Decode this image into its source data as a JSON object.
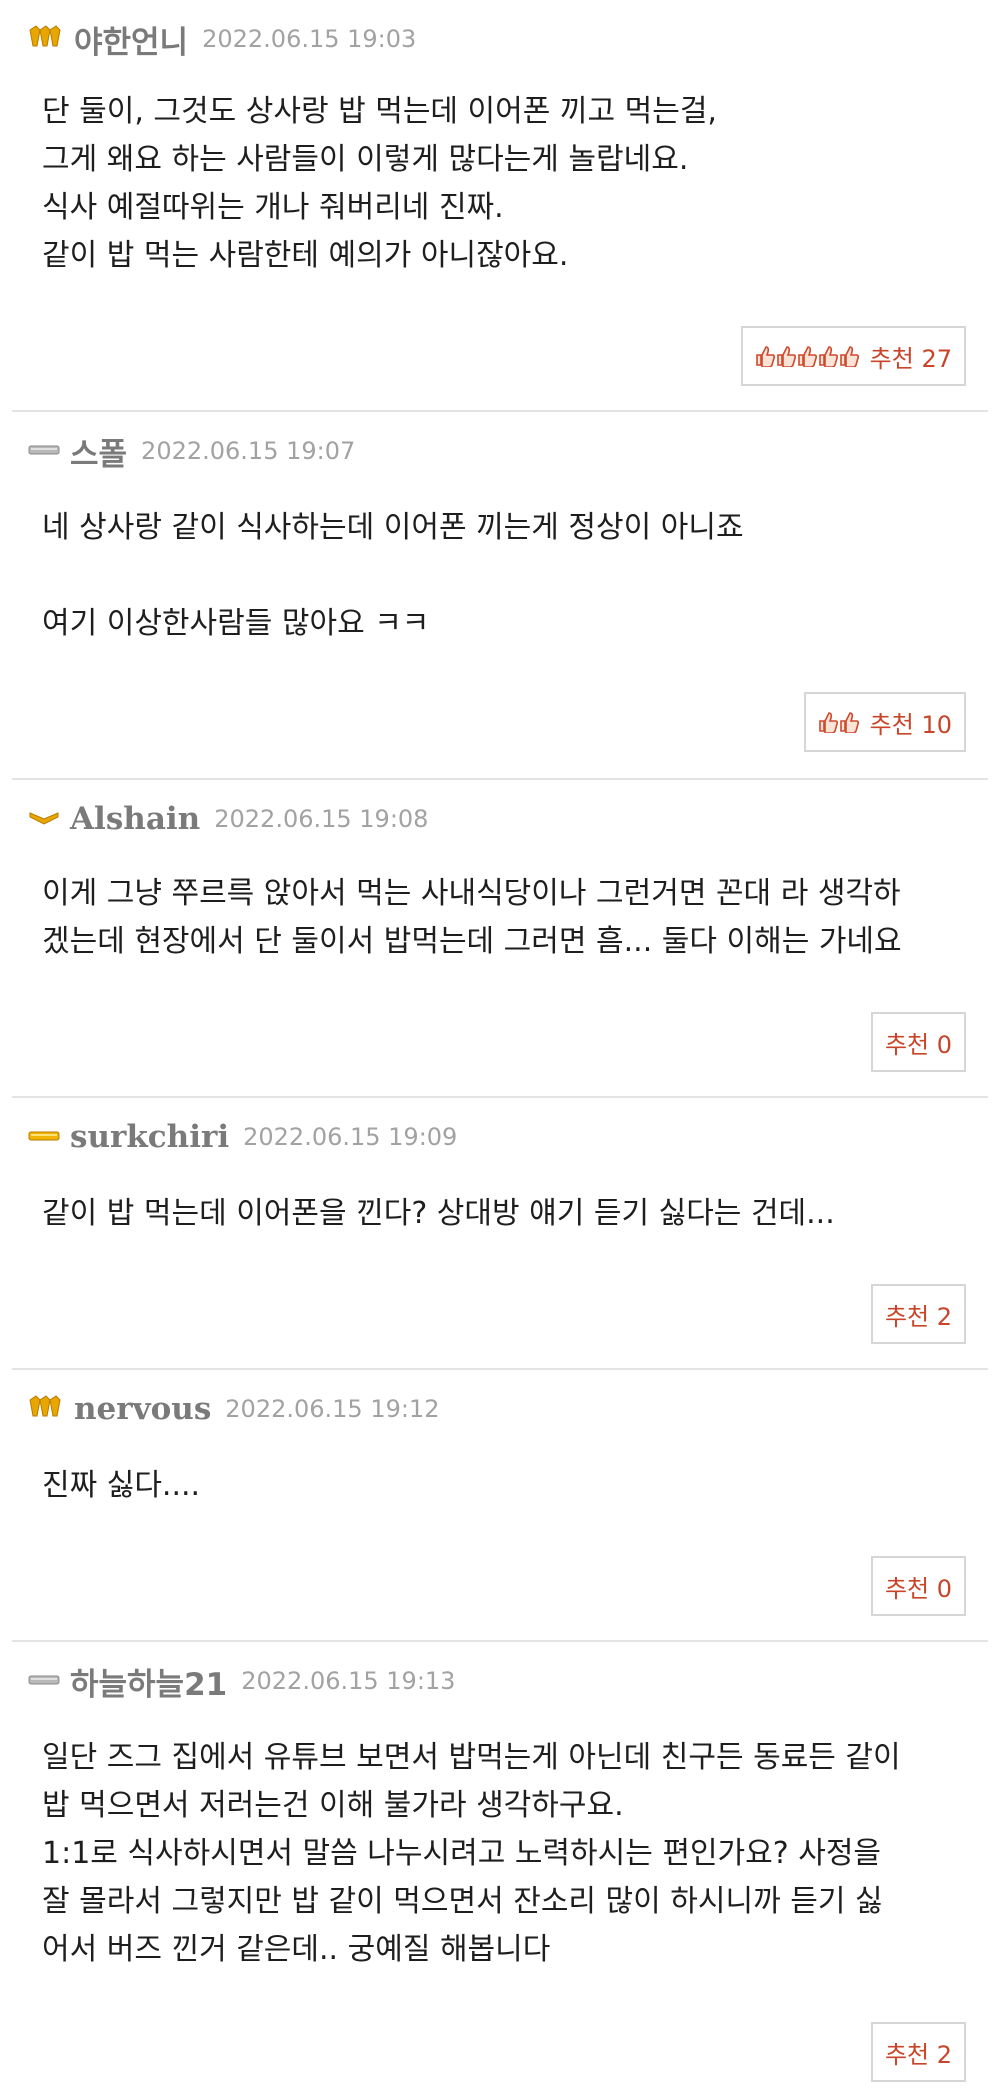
{
  "comments": [
    {
      "nickname": "야한언니",
      "badge": "gold-triple-medal-icon",
      "date": "2022.06.15 19:03",
      "lines": [
        "단 둘이, 그것도 상사랑 밥 먹는데 이어폰 끼고 먹는걸,",
        "그게 왜요 하는 사람들이 이렇게 많다는게 놀랍네요.",
        "식사 예절따위는 개나 줘버리네 진짜.",
        "같이 밥 먹는 사람한테 예의가 아니잖아요."
      ],
      "recommend_label": "추천 27",
      "thumb_count": 5
    },
    {
      "nickname": "스폴",
      "badge": "silver-bar-icon",
      "date": "2022.06.15 19:07",
      "lines": [
        "네 상사랑 같이 식사하는데 이어폰 끼는게 정상이 아니죠",
        "",
        "여기 이상한사람들 많아요 ㅋㅋ"
      ],
      "recommend_label": "추천 10",
      "thumb_count": 2
    },
    {
      "nickname": "Alshain",
      "badge": "gold-chevron-icon",
      "date": "2022.06.15 19:08",
      "lines": [
        "이게 그냥 쭈르륵 앉아서 먹는 사내식당이나 그런거면 꼰대 라 생각하",
        "겠는데 현장에서 단 둘이서 밥먹는데 그러면 흠... 둘다 이해는 가네요"
      ],
      "recommend_label": "추천 0",
      "thumb_count": 0
    },
    {
      "nickname": "surkchiri",
      "badge": "gold-bar-icon",
      "date": "2022.06.15 19:09",
      "lines": [
        "같이 밥 먹는데 이어폰을 낀다? 상대방 얘기 듣기 싫다는 건데..."
      ],
      "recommend_label": "추천 2",
      "thumb_count": 0
    },
    {
      "nickname": "nervous",
      "badge": "gold-triple-medal-icon",
      "date": "2022.06.15 19:12",
      "lines": [
        "진짜 싫다...."
      ],
      "recommend_label": "추천 0",
      "thumb_count": 0
    },
    {
      "nickname": "하늘하늘21",
      "badge": "silver-bar-icon",
      "date": "2022.06.15 19:13",
      "lines": [
        "일단 즈그 집에서 유튜브 보면서 밥먹는게 아닌데 친구든 동료든 같이",
        "밥 먹으면서 저러는건 이해 불가라 생각하구요.",
        "1:1로 식사하시면서 말씀 나누시려고 노력하시는 편인가요? 사정을",
        "잘 몰라서 그렇지만 밥 같이 먹으면서 잔소리 많이 하시니까 듣기 싫",
        "어서 버즈 낀거 같은데.. 궁예질 해봅니다"
      ],
      "recommend_label": "추천 2",
      "thumb_count": 0
    }
  ],
  "colors": {
    "nickname": "#7a7a7a",
    "date": "#a2a2a2",
    "recommend_text": "#c8452a",
    "recommend_border": "#d6d6d6",
    "divider": "#e3e3e3",
    "gold": "#e8a600",
    "silver": "#9a9a9a"
  }
}
